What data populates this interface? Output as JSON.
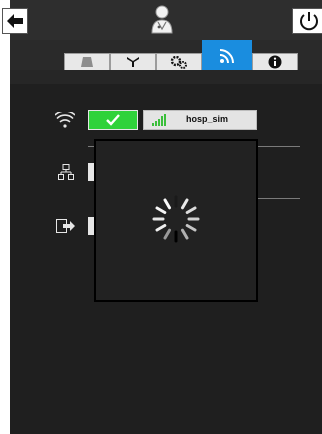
{
  "topbar": {
    "back_icon": "left-arrow-icon",
    "center_icon": "doctor-avatar-icon",
    "right_icon": "power-icon"
  },
  "tabs": [
    {
      "icon": "bed-icon",
      "active": false
    },
    {
      "icon": "antenna-icon",
      "active": false
    },
    {
      "icon": "gears-icon",
      "active": false
    },
    {
      "icon": "wifi-broadcast-icon",
      "active": true
    },
    {
      "icon": "info-icon",
      "active": false
    }
  ],
  "network": {
    "wifi": {
      "icon": "wifi-icon",
      "enabled": true,
      "ssid": "hosp_sim",
      "signal_icon": "signal-bars-icon"
    },
    "ethernet": {
      "icon": "network-tree-icon"
    },
    "export": {
      "icon": "export-icon"
    }
  },
  "modal": {
    "state": "loading",
    "icon": "spinner-icon"
  },
  "colors": {
    "accent": "#1a8ddf",
    "success": "#2fd23a"
  }
}
